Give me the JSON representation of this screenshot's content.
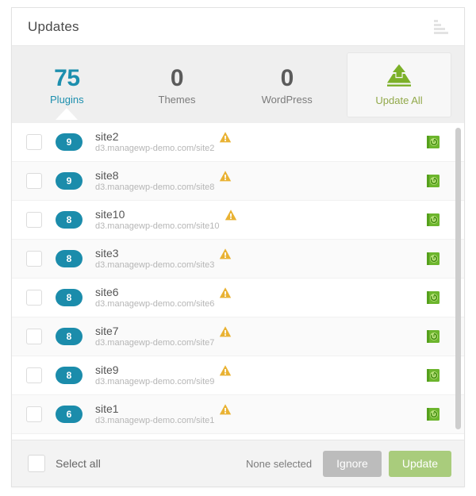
{
  "header": {
    "title": "Updates",
    "menu_icon": "bar-list-icon"
  },
  "summary": {
    "stats": [
      {
        "value": "75",
        "label": "Plugins",
        "active": true
      },
      {
        "value": "0",
        "label": "Themes",
        "active": false
      },
      {
        "value": "0",
        "label": "WordPress",
        "active": false
      }
    ],
    "update_all": {
      "label": "Update All",
      "icon": "upload-icon"
    }
  },
  "colors": {
    "accent_teal": "#1b8cab",
    "green": "#a9cc7c",
    "warning_amber": "#e8b33c",
    "gray_button": "#bcbcbc"
  },
  "list": {
    "rows": [
      {
        "count": "9",
        "name": "site2",
        "url": "d3.managewp-demo.com/site2",
        "warning": "warning-triangle-icon",
        "backup": "backup-history-icon"
      },
      {
        "count": "9",
        "name": "site8",
        "url": "d3.managewp-demo.com/site8",
        "warning": "warning-triangle-icon",
        "backup": "backup-history-icon"
      },
      {
        "count": "8",
        "name": "site10",
        "url": "d3.managewp-demo.com/site10",
        "warning": "warning-triangle-icon",
        "backup": "backup-history-icon"
      },
      {
        "count": "8",
        "name": "site3",
        "url": "d3.managewp-demo.com/site3",
        "warning": "warning-triangle-icon",
        "backup": "backup-history-icon"
      },
      {
        "count": "8",
        "name": "site6",
        "url": "d3.managewp-demo.com/site6",
        "warning": "warning-triangle-icon",
        "backup": "backup-history-icon"
      },
      {
        "count": "8",
        "name": "site7",
        "url": "d3.managewp-demo.com/site7",
        "warning": "warning-triangle-icon",
        "backup": "backup-history-icon"
      },
      {
        "count": "8",
        "name": "site9",
        "url": "d3.managewp-demo.com/site9",
        "warning": "warning-triangle-icon",
        "backup": "backup-history-icon"
      },
      {
        "count": "6",
        "name": "site1",
        "url": "d3.managewp-demo.com/site1",
        "warning": "warning-triangle-icon",
        "backup": "backup-history-icon"
      }
    ]
  },
  "footer": {
    "select_all_label": "Select all",
    "selection_status": "None selected",
    "ignore_label": "Ignore",
    "update_label": "Update"
  }
}
